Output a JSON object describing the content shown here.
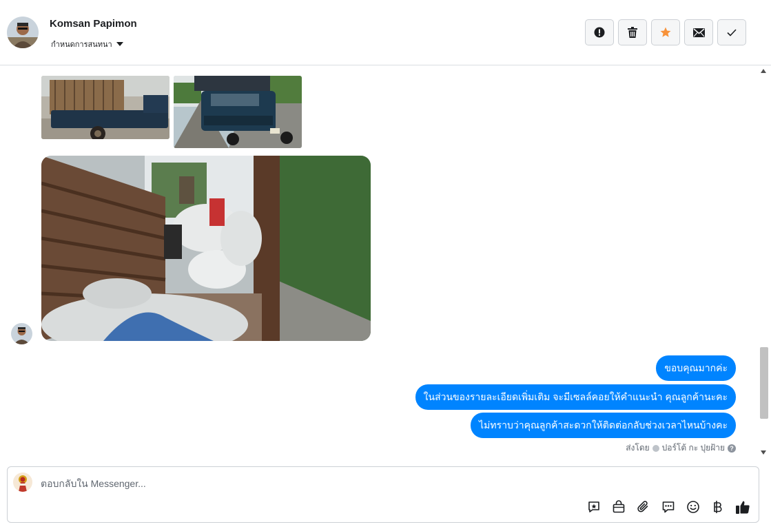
{
  "header": {
    "contact_name": "Komsan Papimon",
    "assign_label": "กำหนดการสนทนา",
    "actions": [
      {
        "name": "spam-button",
        "icon": "alert-icon"
      },
      {
        "name": "delete-button",
        "icon": "trash-icon"
      },
      {
        "name": "star-button",
        "icon": "star-icon"
      },
      {
        "name": "mark-unread-button",
        "icon": "envelope-icon"
      },
      {
        "name": "mark-done-button",
        "icon": "check-icon"
      }
    ]
  },
  "messages": {
    "sent": [
      "ขอบคุณมากค่ะ",
      "ในส่วนของรายละเอียดเพิ่มเติม จะมีเซลล์คอยให้คำแนะนำ คุณลูกค้านะคะ",
      "ไม่ทราบว่าคุณลูกค้าสะดวกให้ติดต่อกลับช่วงเวลาไหนบ้างคะ"
    ],
    "sent_by_label": "ส่งโดย",
    "sent_by_name": "ปอร์โต้ กะ ปุยฝ้าย",
    "help_glyph": "?"
  },
  "composer": {
    "placeholder": "ตอบกลับใน Messenger...",
    "tools": [
      "saved-reply-icon",
      "shop-icon",
      "attachment-icon",
      "faq-icon",
      "emoji-icon",
      "baht-icon",
      "like-icon"
    ]
  },
  "colors": {
    "accent": "#0084ff",
    "star": "#f7923a"
  }
}
